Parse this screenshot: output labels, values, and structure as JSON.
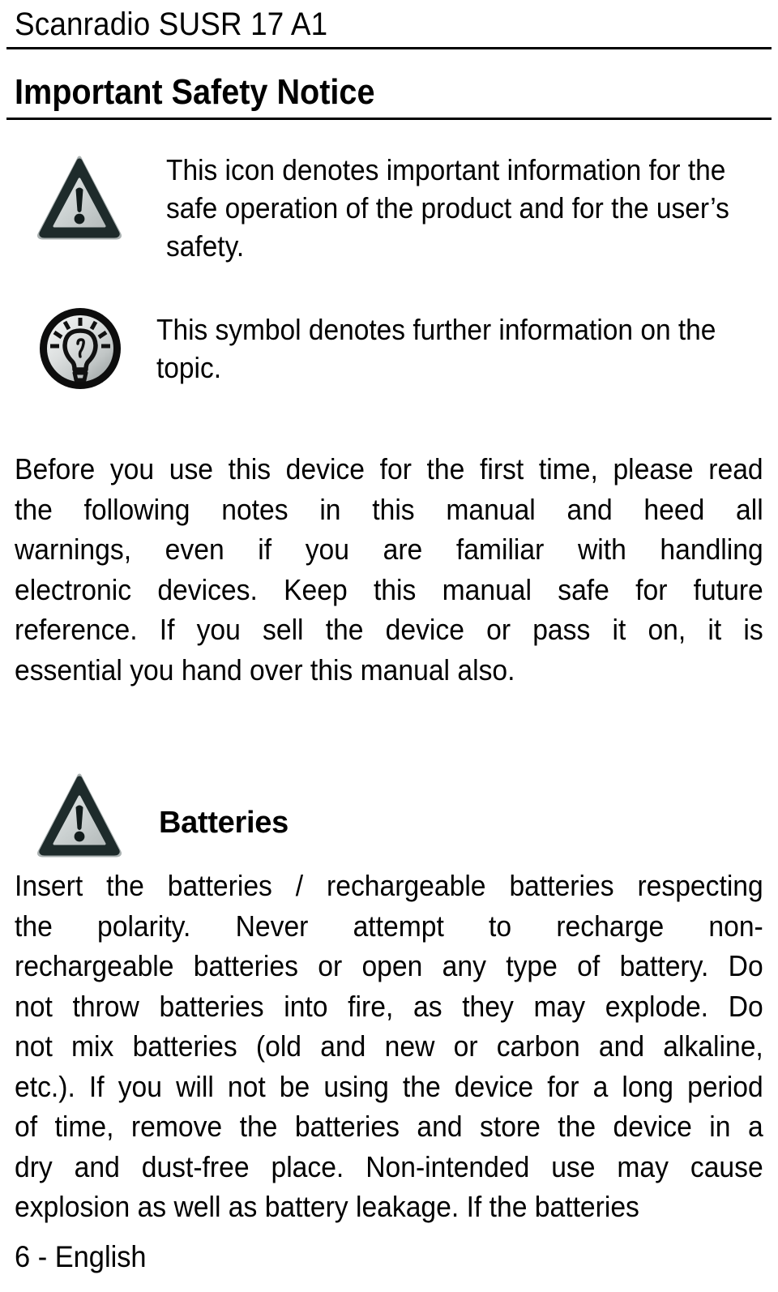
{
  "document": {
    "header_title": "Scanradio SUSR 17 A1",
    "section_title": "Important Safety Notice",
    "footer": "6 - English"
  },
  "icons": [
    {
      "name": "warning-triangle-icon",
      "alt": "Warning triangle with exclamation mark",
      "border_color": "#1e2b2b",
      "fill_color": "#c9cfcf"
    },
    {
      "name": "lightbulb-info-icon",
      "alt": "Circular icon containing a lightbulb with rays",
      "border_color": "#0d0d0d",
      "fill_color": "#d3d7d7"
    }
  ],
  "notes": [
    {
      "icon": "warning-triangle-icon",
      "text": "This icon denotes important information for the safe operation of the product and for the user’s safety."
    },
    {
      "icon": "lightbulb-info-icon",
      "text": "This symbol denotes further information on the topic."
    }
  ],
  "paragraphs": {
    "intro": {
      "text": "Before you use this device for the first time, please read the following notes in this manual and heed all warnings, even if you are familiar with handling electronic devices. Keep this manual safe for future reference. If you sell the device or pass it on, it is essential you hand over this manual also.",
      "lines": [
        "Before you use this device for the first time, please read",
        "the following notes in this manual and heed all",
        "warnings, even if you are familiar with handling",
        "electronic devices. Keep this manual safe for future",
        "reference. If you sell the device or pass it on, it is",
        "essential you hand over this manual also."
      ]
    },
    "batteries": {
      "heading": "Batteries",
      "text": "Insert the batteries / rechargeable batteries respecting the polarity. Never attempt to recharge non-rechargeable batteries or open any type of battery. Do not throw batteries into fire, as they may explode. Do not mix batteries (old and new or carbon and alkaline, etc.). If you will not be using the device for a long period of time, remove the batteries and store the device in a dry and dust-free place. Non-intended use may cause explosion as well as battery leakage. If the batteries",
      "lines": [
        "Insert the batteries / rechargeable batteries respecting",
        "the polarity. Never attempt to recharge non-",
        "rechargeable batteries or open any type of battery. Do",
        "not throw batteries into fire, as they may explode. Do",
        "not mix batteries (old and new or carbon and alkaline,",
        "etc.). If you will not be using the device for a long period",
        "of time, remove the batteries and store the device in a",
        "dry and dust-free place. Non-intended use may cause",
        "explosion as well as battery leakage. If the batteries"
      ]
    }
  }
}
